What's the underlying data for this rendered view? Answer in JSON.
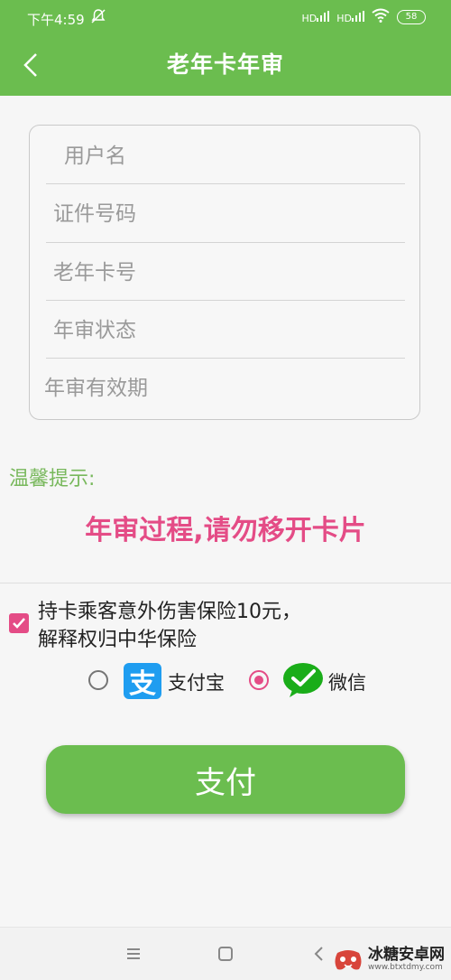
{
  "status_bar": {
    "time": "下午4:59",
    "signal_label": "HD",
    "battery": "58"
  },
  "app_bar": {
    "title": "老年卡年审",
    "back_icon": "chevron-left-icon"
  },
  "form": {
    "fields": [
      {
        "value": "",
        "placeholder": "用户名"
      },
      {
        "value": "",
        "placeholder": "证件号码"
      },
      {
        "value": "",
        "placeholder": "老年卡号"
      },
      {
        "value": "",
        "placeholder": "年审状态"
      },
      {
        "value": "",
        "placeholder": "年审有效期"
      }
    ]
  },
  "tip": {
    "label": "温馨提示:",
    "message": "年审过程,请勿移开卡片"
  },
  "insurance": {
    "checked": true,
    "line1": "持卡乘客意外伤害保险10元，",
    "line2": "解释权归中华保险"
  },
  "payment": {
    "options": [
      {
        "label": "支付宝",
        "selected": false,
        "icon": "alipay-icon",
        "glyph": "支"
      },
      {
        "label": "微信",
        "selected": true,
        "icon": "wechat-pay-icon"
      }
    ]
  },
  "pay_button": {
    "label": "支付"
  },
  "watermark": {
    "line1": "冰糖安卓网",
    "line2": "www.btxtdmy.com"
  },
  "colors": {
    "primary_green": "#6bbd4f",
    "accent_pink": "#e44c86",
    "tip_green": "#78b85c",
    "alipay_blue": "#1f9df0",
    "wechat_green": "#1aad19"
  }
}
